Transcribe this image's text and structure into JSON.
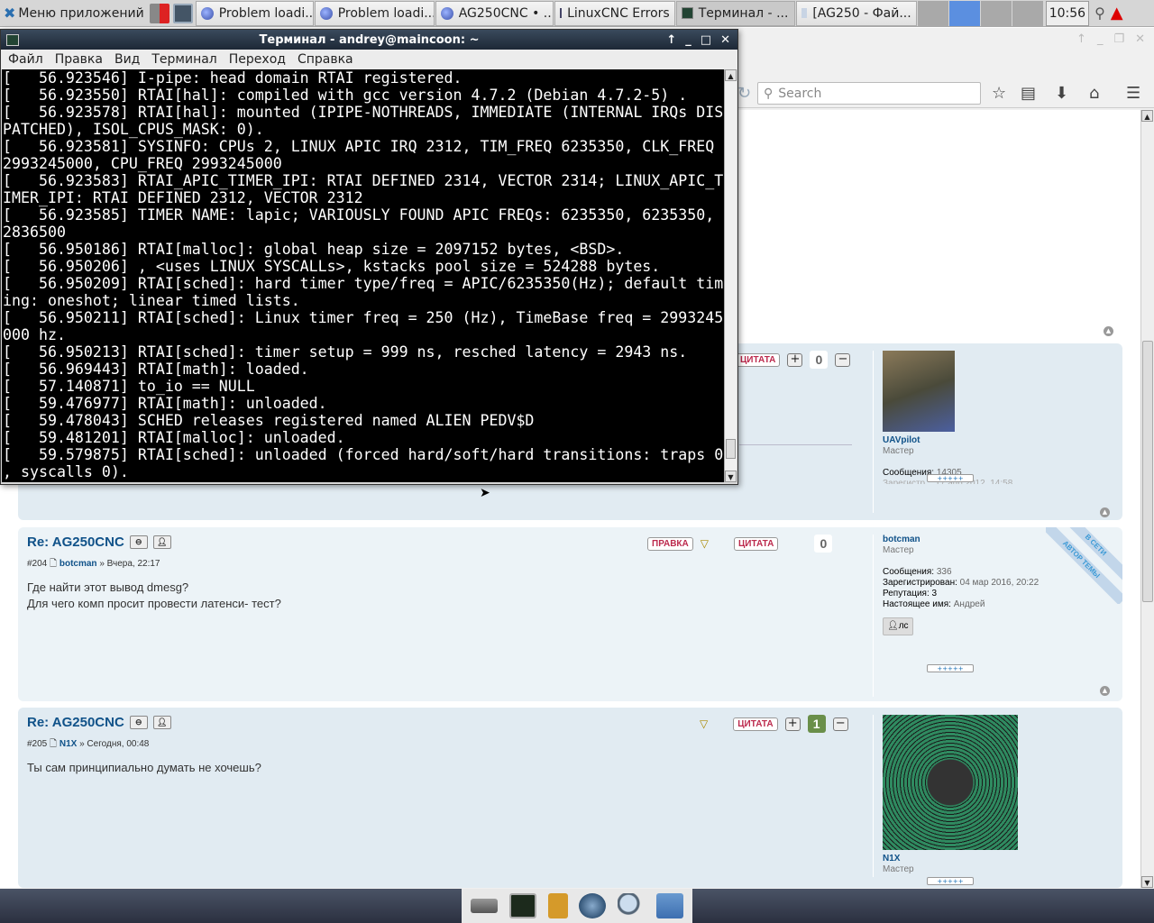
{
  "taskbar": {
    "app_menu": "Меню приложений",
    "tasks": [
      {
        "label": "Problem loadi...",
        "icon": "firefox-icon"
      },
      {
        "label": "Problem loadi...",
        "icon": "firefox-icon"
      },
      {
        "label": "AG250CNC • ...",
        "icon": "firefox-icon"
      },
      {
        "label": "LinuxCNC Errors",
        "icon": "window-icon"
      },
      {
        "label": "Терминал - ...",
        "icon": "terminal-icon",
        "active": true
      },
      {
        "label": "[AG250 - Фай...",
        "icon": "folder-icon"
      }
    ],
    "clock": "10:56"
  },
  "browser": {
    "search_placeholder": "Search"
  },
  "terminal": {
    "title": "Терминал - andrey@maincoon: ~",
    "menu": [
      "Файл",
      "Правка",
      "Вид",
      "Терминал",
      "Переход",
      "Справка"
    ],
    "lines": [
      "[   56.923546] I-pipe: head domain RTAI registered.",
      "[   56.923550] RTAI[hal]: compiled with gcc version 4.7.2 (Debian 4.7.2-5) .",
      "[   56.923578] RTAI[hal]: mounted (IPIPE-NOTHREADS, IMMEDIATE (INTERNAL IRQs DIS",
      "PATCHED), ISOL_CPUS_MASK: 0).",
      "[   56.923581] SYSINFO: CPUs 2, LINUX APIC IRQ 2312, TIM_FREQ 6235350, CLK_FREQ",
      "2993245000, CPU_FREQ 2993245000",
      "[   56.923583] RTAI_APIC_TIMER_IPI: RTAI DEFINED 2314, VECTOR 2314; LINUX_APIC_T",
      "IMER_IPI: RTAI DEFINED 2312, VECTOR 2312",
      "[   56.923585] TIMER NAME: lapic; VARIOUSLY FOUND APIC FREQs: 6235350, 6235350,",
      "2836500",
      "[   56.950186] RTAI[malloc]: global heap size = 2097152 bytes, <BSD>.",
      "[   56.950206] , <uses LINUX SYSCALLs>, kstacks pool size = 524288 bytes.",
      "[   56.950209] RTAI[sched]: hard timer type/freq = APIC/6235350(Hz); default tim",
      "ing: oneshot; linear timed lists.",
      "[   56.950211] RTAI[sched]: Linux timer freq = 250 (Hz), TimeBase freq = 2993245",
      "000 hz.",
      "[   56.950213] RTAI[sched]: timer setup = 999 ns, resched latency = 2943 ns.",
      "[   56.969443] RTAI[math]: loaded.",
      "[   57.140871] to_io == NULL",
      "[   59.476977] RTAI[math]: unloaded.",
      "[   59.478043] SCHED releases registered named ALIEN PEDV$D",
      "[   59.481201] RTAI[malloc]: unloaded.",
      "[   59.579875] RTAI[sched]: unloaded (forced hard/soft/hard transitions: traps 0",
      ", syscalls 0)."
    ]
  },
  "forum": {
    "buttons": {
      "edit": "ПРАВКА",
      "quote": "ЦИТАТА",
      "pm": "ЛС"
    },
    "post_prev": {
      "score": "0",
      "user": "UAVpilot",
      "rank": "Мастер",
      "messages_label": "Сообщения:",
      "messages": "14305",
      "registered_partial": "Зарегистр... 17 апр 2012, 14:58"
    },
    "post_204": {
      "title": "Re: AG250CNC",
      "number": "#204",
      "author": "botcman",
      "date": "» Вчера, 22:17",
      "body": [
        "Где найти этот вывод dmesg?",
        "Для чего комп просит провести латенси- тест?"
      ],
      "score": "0",
      "rank": "Мастер",
      "ribbon_online": "В СЕТИ",
      "ribbon_author": "АВТОР ТЕМЫ",
      "messages_label": "Сообщения:",
      "messages": "336",
      "registered_label": "Зарегистрирован:",
      "registered": "04 мар 2016, 20:22",
      "reputation": "Репутация: 3",
      "realname_label": "Настоящее имя:",
      "realname": "Андрей"
    },
    "post_205": {
      "title": "Re: AG250CNC",
      "number": "#205",
      "author": "N1X",
      "date": "» Сегодня, 00:48",
      "body": "Ты сам принципиально думать не хочешь?",
      "score": "1",
      "rank": "Мастер"
    },
    "stars": "+++++"
  }
}
